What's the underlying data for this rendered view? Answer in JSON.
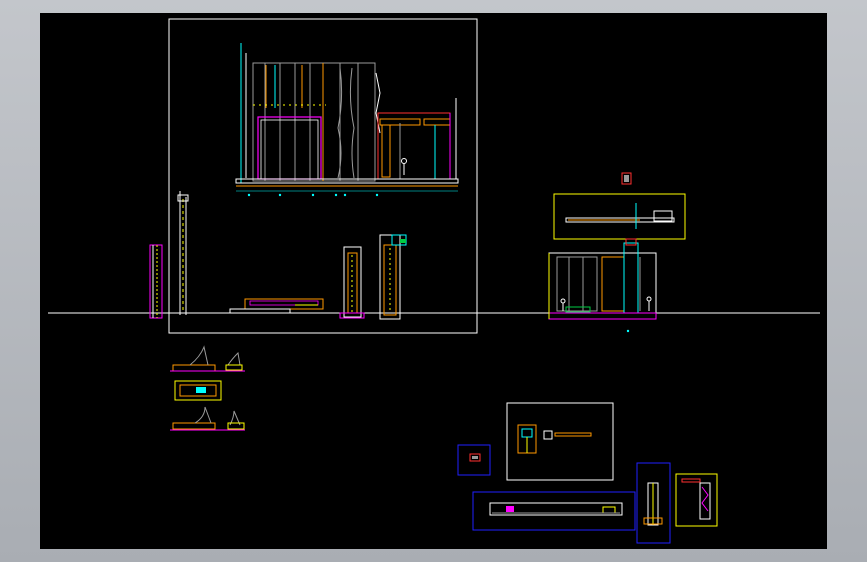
{
  "app": {
    "view": "cad-drawing-canvas",
    "background_color": "#000000",
    "frame_color": "#b4b8be"
  },
  "palette": {
    "white": "#ffffff",
    "yellow": "#ffff00",
    "cyan": "#00ffff",
    "magenta": "#ff00ff",
    "red": "#ff3030",
    "orange": "#ff9900",
    "blue": "#2020ff",
    "green": "#00cc44",
    "gray": "#9a9a9a"
  }
}
